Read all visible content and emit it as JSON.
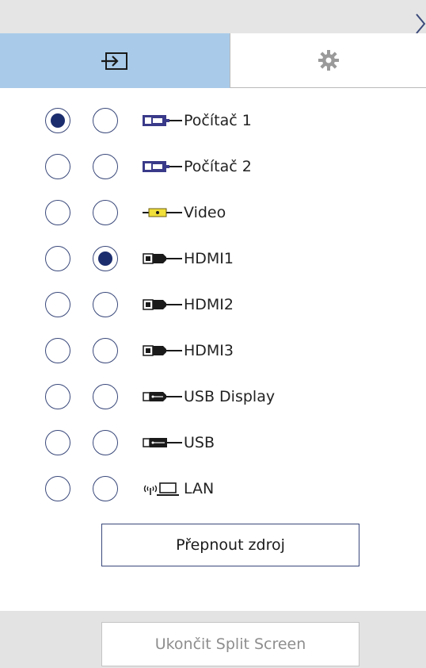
{
  "colors": {
    "accent_tab": "#a9cbe9",
    "radio_border": "#39487a",
    "radio_fill": "#1c2d6e",
    "bar_background": "#e5e5e5"
  },
  "header": {
    "close_icon": "chevron-right-icon"
  },
  "tabs": [
    {
      "name": "source-input",
      "icon": "input-source-icon",
      "selected": true
    },
    {
      "name": "settings",
      "icon": "gear-icon",
      "selected": false
    }
  ],
  "sources": [
    {
      "label": "Počítač 1",
      "icon": "vga-cable-icon",
      "col1_selected": true,
      "col2_selected": false
    },
    {
      "label": "Počítač 2",
      "icon": "vga-cable-icon",
      "col1_selected": false,
      "col2_selected": false
    },
    {
      "label": "Video",
      "icon": "rca-cable-icon",
      "col1_selected": false,
      "col2_selected": false
    },
    {
      "label": "HDMI1",
      "icon": "hdmi-cable-icon",
      "col1_selected": false,
      "col2_selected": true
    },
    {
      "label": "HDMI2",
      "icon": "hdmi-cable-icon",
      "col1_selected": false,
      "col2_selected": false
    },
    {
      "label": "HDMI3",
      "icon": "hdmi-cable-icon",
      "col1_selected": false,
      "col2_selected": false
    },
    {
      "label": "USB Display",
      "icon": "usb-display-cable-icon",
      "col1_selected": false,
      "col2_selected": false
    },
    {
      "label": "USB",
      "icon": "usb-cable-icon",
      "col1_selected": false,
      "col2_selected": false
    },
    {
      "label": "LAN",
      "icon": "lan-wireless-icon",
      "col1_selected": false,
      "col2_selected": false
    }
  ],
  "buttons": {
    "switch_source": "Přepnout zdroj",
    "end_split_screen": "Ukončit Split Screen"
  }
}
